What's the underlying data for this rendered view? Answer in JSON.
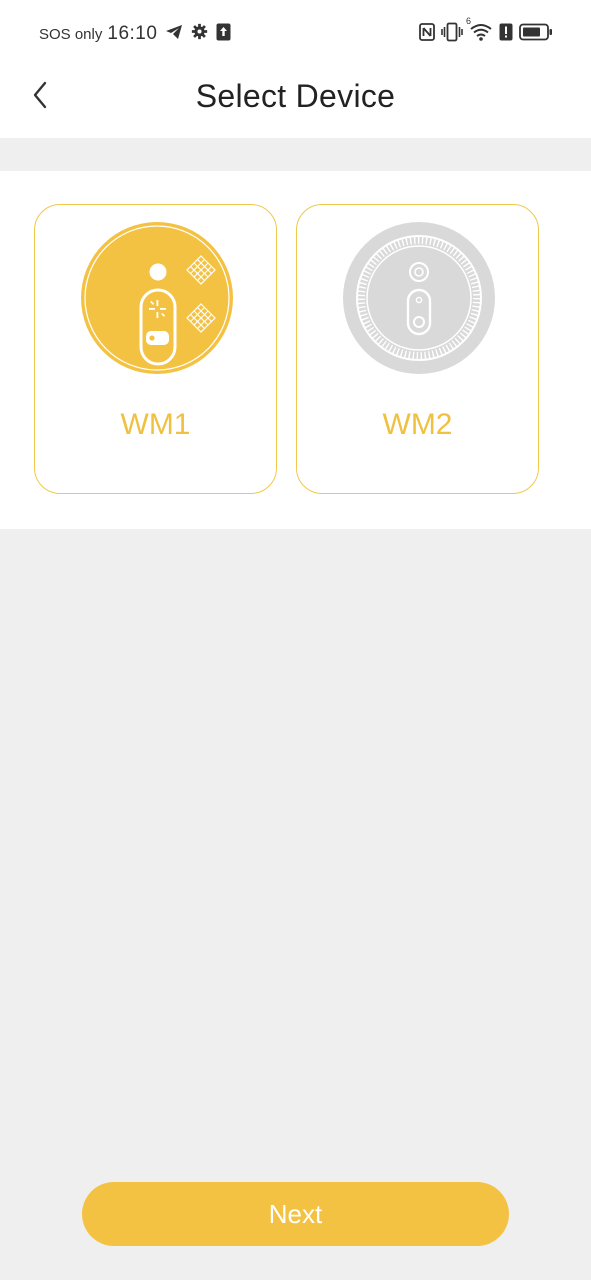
{
  "status_bar": {
    "carrier": "SOS only",
    "time": "16:10",
    "left_icons": [
      "telegram-icon",
      "gear-icon",
      "upload-icon"
    ],
    "right_icons": [
      "nfc-icon",
      "vibrate-icon",
      "wifi-icon",
      "alert-icon",
      "battery-icon"
    ],
    "wifi_label": "6"
  },
  "header": {
    "title": "Select Device",
    "back_icon": "chevron-left-icon"
  },
  "devices": [
    {
      "label": "WM1",
      "selected": true,
      "icon": "wm1-device-icon"
    },
    {
      "label": "WM2",
      "selected": false,
      "icon": "wm2-device-icon"
    }
  ],
  "footer": {
    "next_label": "Next"
  },
  "colors": {
    "accent": "#f4c243",
    "accent_text": "#f0c040",
    "background": "#efefef",
    "inactive": "#d9d9d9"
  }
}
